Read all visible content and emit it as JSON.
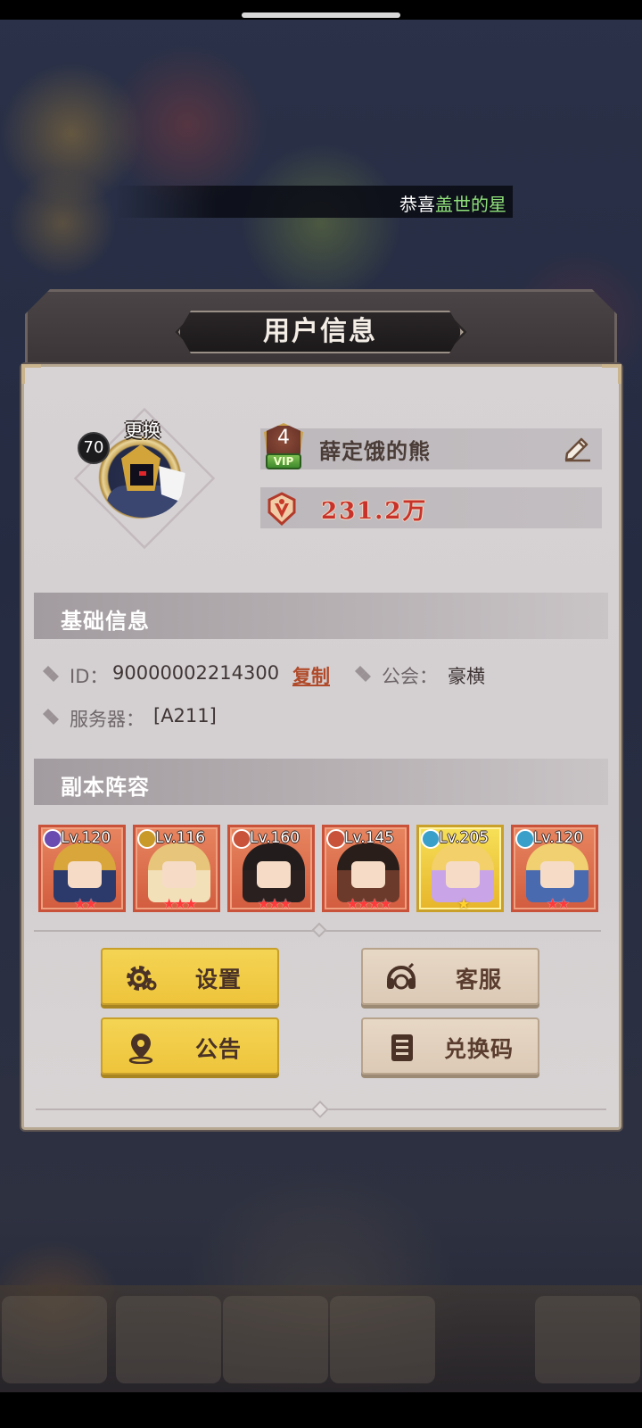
{
  "marquee": {
    "prefix": "恭喜",
    "highlight": "盖世的星"
  },
  "header": {
    "title": "用户信息"
  },
  "profile": {
    "level": "70",
    "change_avatar_label": "更换",
    "vip_level": "4",
    "vip_tag": "VIP",
    "name": "薛定饿的熊",
    "power": "231.2万"
  },
  "basic_info": {
    "title": "基础信息",
    "id_label": "ID：",
    "id_value": "90000002214300",
    "copy_label": "复制",
    "guild_label": "公会：",
    "guild_value": "豪横",
    "server_label": "服务器：",
    "server_value": "[A211]"
  },
  "lineup": {
    "title": "副本阵容",
    "heroes": [
      {
        "level": "Lv.120",
        "stars": "★★",
        "color": "#2b3a6b",
        "hair": "#d8a63a",
        "class_color": "#6a4bb0"
      },
      {
        "level": "Lv.116",
        "stars": "★★★",
        "color": "#f2e0b8",
        "hair": "#e7c57a",
        "class_color": "#c99a2a"
      },
      {
        "level": "Lv.160",
        "stars": "★★★",
        "color": "#2a2020",
        "hair": "#231c1c",
        "class_color": "#c9523a"
      },
      {
        "level": "Lv.145",
        "stars": "★★★★",
        "color": "#6b3a2a",
        "hair": "#2a1e1a",
        "class_color": "#c9523a"
      },
      {
        "level": "Lv.205",
        "stars": "★",
        "color": "#c9a5e8",
        "hair": "#f3d06a",
        "class_color": "#3aa0c9"
      },
      {
        "level": "Lv.120",
        "stars": "★★",
        "color": "#4a6ab0",
        "hair": "#f0d070",
        "class_color": "#3aa0c9"
      }
    ]
  },
  "buttons": {
    "settings": "设置",
    "customer_service": "客服",
    "announcement": "公告",
    "redeem_code": "兑换码"
  },
  "icons": {
    "edit": "edit-pencil-icon",
    "power": "crest-icon",
    "settings": "gear-icon",
    "customer_service": "headset-icon",
    "announcement": "location-pin-icon",
    "redeem_code": "notebook-icon"
  }
}
